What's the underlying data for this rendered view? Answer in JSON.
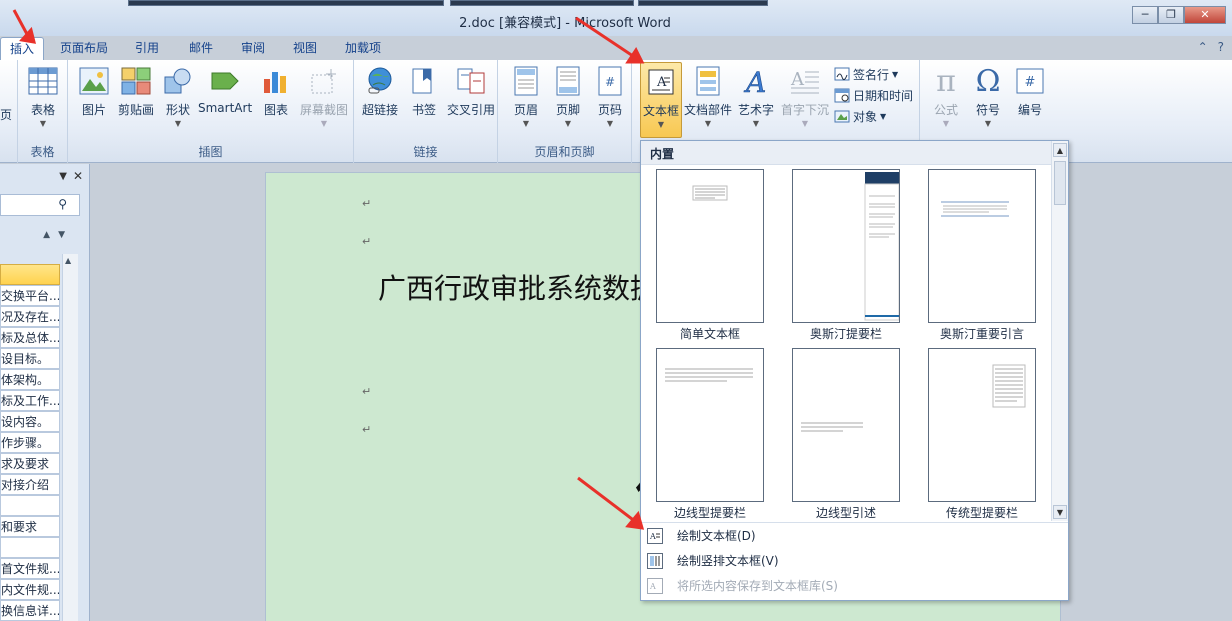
{
  "window": {
    "title": "2.doc [兼容模式] - Microsoft Word"
  },
  "tabs": [
    {
      "label": "插入",
      "active": true
    },
    {
      "label": "页面布局"
    },
    {
      "label": "引用"
    },
    {
      "label": "邮件"
    },
    {
      "label": "审阅"
    },
    {
      "label": "视图"
    },
    {
      "label": "加载项"
    }
  ],
  "ribbon": {
    "groups": {
      "tables": {
        "label": "表格",
        "buttons": [
          "表格"
        ]
      },
      "illustrations": {
        "label": "插图",
        "buttons": [
          "图片",
          "剪贴画",
          "形状",
          "SmartArt",
          "图表",
          "屏幕截图"
        ]
      },
      "links": {
        "label": "链接",
        "buttons": [
          "超链接",
          "书签",
          "交叉引用"
        ]
      },
      "header_footer": {
        "label": "页眉和页脚",
        "buttons": [
          "页眉",
          "页脚",
          "页码"
        ]
      },
      "text": {
        "buttons": [
          "文本框",
          "文档部件",
          "艺术字",
          "首字下沉"
        ],
        "small": [
          "签名行",
          "日期和时间",
          "对象"
        ]
      },
      "symbols": {
        "buttons": [
          "公式",
          "符号",
          "编号"
        ]
      }
    },
    "left_cut_label": "页"
  },
  "nav": {
    "items": [
      "",
      "交换平台...",
      "况及存在...",
      "标及总体...",
      "设目标。",
      "体架构。",
      "标及工作...",
      "设内容。",
      "作步骤。",
      "求及要求",
      "对接介绍",
      "",
      "和要求",
      "",
      "首文件规...",
      "内文件规...",
      "换信息详..."
    ]
  },
  "document": {
    "heading": "广西行政审批系统数据",
    "bigglyph": "伝"
  },
  "gallery": {
    "header": "内置",
    "thumbs": [
      "简单文本框",
      "奥斯汀提要栏",
      "奥斯汀重要引言",
      "边线型提要栏",
      "边线型引述",
      "传统型提要栏"
    ],
    "menu": [
      {
        "label": "绘制文本框(D)",
        "disabled": false
      },
      {
        "label": "绘制竖排文本框(V)",
        "disabled": false
      },
      {
        "label": "将所选内容保存到文本框库(S)",
        "disabled": true
      }
    ]
  },
  "colors": {
    "accent": "#15428b",
    "arrow": "#e8312a",
    "page": "#cde8d0",
    "pressed": "#f8c852"
  }
}
